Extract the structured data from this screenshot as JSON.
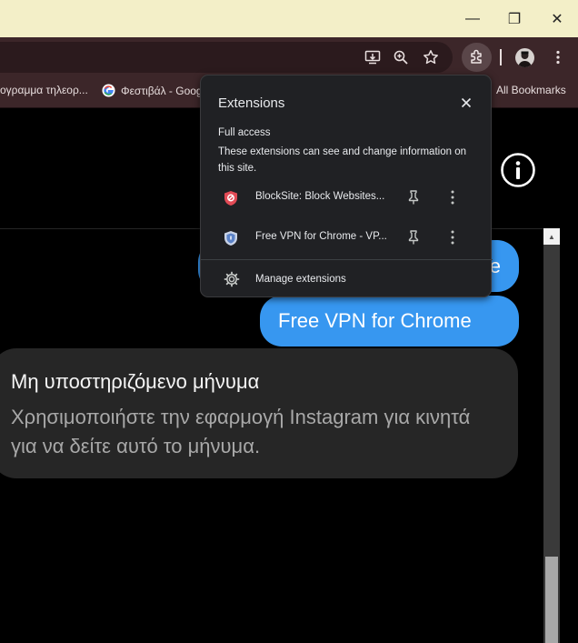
{
  "window": {
    "minimize_glyph": "—",
    "maximize_glyph": "❐",
    "close_glyph": "✕"
  },
  "toolbar": {
    "icons": [
      "install-app-icon",
      "zoom-icon",
      "bookmark-star-icon",
      "extensions-puzzle-icon",
      "profile-avatar",
      "menu-kebab-icon"
    ]
  },
  "bookmarks": {
    "items": [
      {
        "label": "ογραμμα τηλεορ..."
      },
      {
        "label": "Φεστιβάλ - Goog"
      }
    ],
    "all_bookmarks": "All Bookmarks"
  },
  "extensions_popup": {
    "title": "Extensions",
    "section_title": "Full access",
    "section_desc": "These extensions can see and change information on this site.",
    "items": [
      {
        "name": "BlockSite: Block Websites...",
        "icon": "blocksite-shield-icon"
      },
      {
        "name": "Free VPN for Chrome - VP...",
        "icon": "vpn-shield-icon"
      }
    ],
    "manage_label": "Manage extensions"
  },
  "chat": {
    "partial_bubble_text": "e",
    "sent_bubble_text": "Free VPN for Chrome",
    "received_title": "Μη υποστηριζόμενο μήνυμα",
    "received_body": "Χρησιμοποιήστε την εφαρμογή Instagram για κινητά για να δείτε αυτό το μήνυμα."
  },
  "colors": {
    "accent_blue": "#3797f0",
    "titlebar": "#f3efc8",
    "toolbar": "#3c2629",
    "popup_bg": "#202124"
  }
}
